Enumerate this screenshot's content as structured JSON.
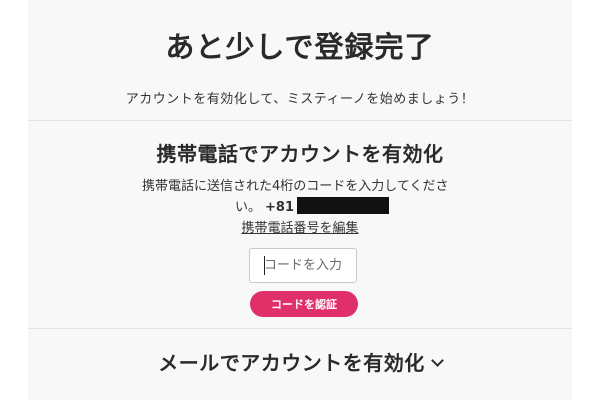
{
  "header": {
    "title": "あと少しで登録完了",
    "subtitle": "アカウントを有効化して、ミスティーノを始めましょう！"
  },
  "phone_section": {
    "title": "携帯電話でアカウントを有効化",
    "desc_line1": "携帯電話に送信された4桁のコードを入力してくださ",
    "desc_line2": "い。",
    "phone_prefix": "+81",
    "edit_link": "携帯電話番号を編集",
    "code_placeholder": "コードを入力",
    "verify_button": "コードを認証"
  },
  "mail_section": {
    "toggle_label": "メールでアカウントを有効化",
    "chevron_icon": "chevron-down-icon"
  },
  "colors": {
    "accent": "#e0306a",
    "panel_bg": "#f8f8f8"
  }
}
